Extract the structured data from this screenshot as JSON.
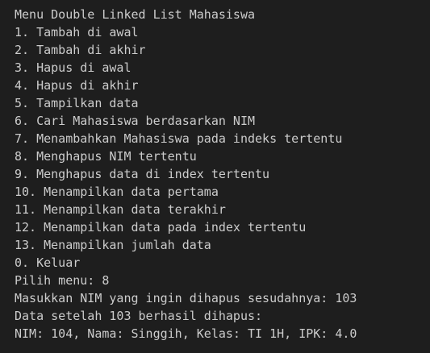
{
  "menu": {
    "title": "Menu Double Linked List Mahasiswa",
    "items": [
      "1. Tambah di awal",
      "2. Tambah di akhir",
      "3. Hapus di awal",
      "4. Hapus di akhir",
      "5. Tampilkan data",
      "6. Cari Mahasiswa berdasarkan NIM",
      "7. Menambahkan Mahasiswa pada indeks tertentu",
      "8. Menghapus NIM tertentu",
      "9. Menghapus data di index tertentu",
      "10. Menampilkan data pertama",
      "11. Menampilkan data terakhir",
      "12. Menampilkan data pada index tertentu",
      "13. Menampilkan jumlah data",
      "0. Keluar"
    ]
  },
  "session": {
    "prompt": "Pilih menu: 8",
    "input_prompt": "Masukkan NIM yang ingin dihapus sesudahnya: 103",
    "result_header": "Data setelah 103 berhasil dihapus:",
    "result_row": "NIM: 104, Nama: Singgih, Kelas: TI 1H, IPK: 4.0"
  },
  "colors": {
    "background": "#1e1e1e",
    "text": "#cccccc"
  }
}
